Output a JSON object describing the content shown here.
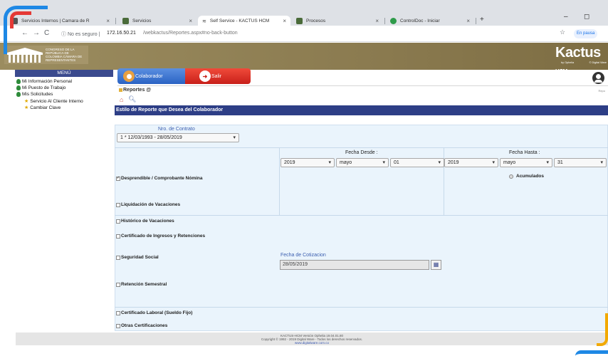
{
  "browser": {
    "tabs": [
      {
        "label": "Servicios Internos | Camara de R",
        "active": false
      },
      {
        "label": "Servicios",
        "active": false
      },
      {
        "label": "Self Service - KACTUS HCM",
        "active": true
      },
      {
        "label": "Procesos",
        "active": false
      },
      {
        "label": "ControlDoc - Iniciar",
        "active": false
      }
    ],
    "new_tab": "+",
    "security": "No es seguro",
    "url_host": "172.16.50.21",
    "url_path": "/webkactus/Reportes.aspx#no-back-button",
    "pause_label": "En pausa"
  },
  "header": {
    "congress_text": "CONGRESO DE LA REPÚBLICA DE COLOMBIA CÁMARA DE REPRESENTANTES",
    "logo": "Kactus",
    "logo_suffix": "HCM",
    "logo_by": "by Ophelia",
    "logo_by2": "© Digital Ware"
  },
  "menu": {
    "title": "MENÚ",
    "items": [
      {
        "label": "Mi Información Personal",
        "icon": "person-icon"
      },
      {
        "label": "Mi Puesto de Trabajo",
        "icon": "person-icon"
      },
      {
        "label": "Mis Solicitudes",
        "icon": "person-icon"
      },
      {
        "label": "Servicio Al Cliente Interno",
        "icon": "star-icon"
      },
      {
        "label": "Cambiar Clave",
        "icon": "star-icon"
      }
    ]
  },
  "topbar": {
    "colaborador": "Colaborador",
    "salir": "Salir"
  },
  "reportes": {
    "title": "Reportes @",
    "right_text": "Repo"
  },
  "section": {
    "title": "Estilo de Reporte que Desea del Colaborador"
  },
  "contract": {
    "label": "Nro. de Contrato",
    "value": "1 * 12/03/1993 - 28/05/2019"
  },
  "dates": {
    "desde_label": "Fecha Desde :",
    "hasta_label": "Fecha Hasta :",
    "desde_year": "2019",
    "desde_month": "mayo",
    "desde_day": "01",
    "hasta_year": "2019",
    "hasta_month": "mayo",
    "hasta_day": "31"
  },
  "options": {
    "desprendible": "Desprendible / Comprobante Nómina",
    "acumulados": "Acumulados",
    "liquidacion": "Liquidación de Vacaciones",
    "historico": "Histórico de Vacaciones",
    "certificado_ingresos": "Certificado de Ingresos y Retenciones",
    "seguridad": "Seguridad Social",
    "retencion": "Retención Semestral",
    "certificado_laboral": "Certificado Laboral (Sueldo Fijo)",
    "otras": "Otras Certificaciones"
  },
  "cotizacion": {
    "label": "Fecha de Cotizacion",
    "value": "28/05/2019"
  },
  "footer": {
    "line1": "KACTUS-HCM Versión Ophelia 19.04.01.80",
    "line2": "Copyright © 1992 - 2019 Digital Ware - Todos los derechos reservados.",
    "line3": "www.digitalware.com.co"
  },
  "colors": {
    "header_gold": "#8b7b50",
    "section_navy": "#2d3e86",
    "form_bg": "#eaf4fc",
    "btn_blue": "#2a63c4",
    "btn_red": "#c8201a"
  }
}
